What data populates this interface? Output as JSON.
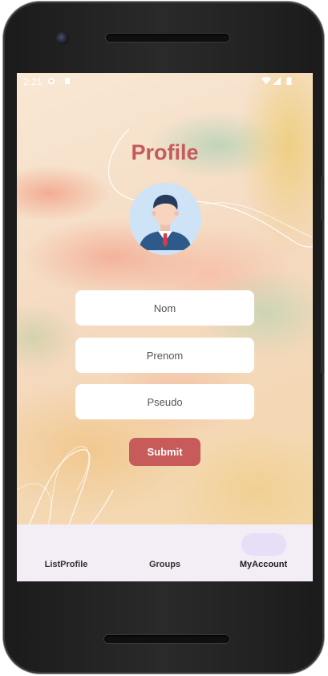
{
  "status_bar": {
    "time": "2:21"
  },
  "profile": {
    "title": "Profile",
    "nom_placeholder": "Nom",
    "prenom_placeholder": "Prenom",
    "pseudo_placeholder": "Pseudo",
    "submit_label": "Submit"
  },
  "bottom_nav": {
    "items": [
      {
        "label": "ListProfile",
        "icon": "list-icon",
        "active": false
      },
      {
        "label": "Groups",
        "icon": "groups-icon",
        "active": false
      },
      {
        "label": "MyAccount",
        "icon": "account-icon",
        "active": true
      }
    ]
  },
  "colors": {
    "accent": "#c65a5c",
    "submit_bg": "#c75b5a",
    "nav_bg": "#f3edf6",
    "nav_pill_active": "#e8def8"
  }
}
